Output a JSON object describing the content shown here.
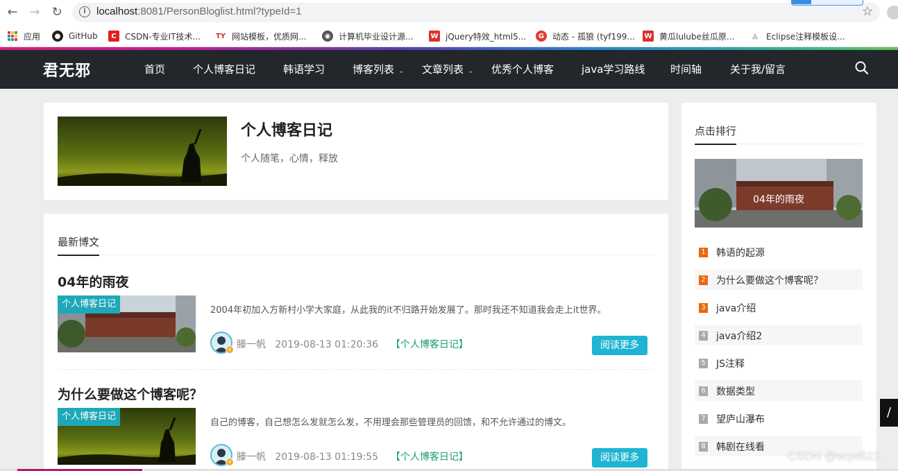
{
  "browser": {
    "url_host": "localhost",
    "url_rest": ":8081/PersonBloglist.html?typeId=1",
    "bookmarks": [
      {
        "label": "应用",
        "icon": "apps-grid-icon"
      },
      {
        "label": "GitHub",
        "icon": "github-icon"
      },
      {
        "label": "CSDN-专业IT技术...",
        "icon": "csdn-icon"
      },
      {
        "label": "网站模板，优质网...",
        "icon": "ty-icon"
      },
      {
        "label": "计算机毕业设计源...",
        "icon": "globe-icon"
      },
      {
        "label": "jQuery特效_html5...",
        "icon": "jq-icon"
      },
      {
        "label": "动态 - 孤狼 (tyf199...",
        "icon": "weibo-icon"
      },
      {
        "label": "黄瓜lulube丝瓜原...",
        "icon": "jq-icon"
      },
      {
        "label": "Eclipse注释模板设...",
        "icon": "eclipse-icon"
      }
    ]
  },
  "site": {
    "logo": "君无邪",
    "menu": [
      {
        "label": "首页",
        "dropdown": false
      },
      {
        "label": "个人博客日记",
        "dropdown": false
      },
      {
        "label": "韩语学习",
        "dropdown": false
      },
      {
        "label": "博客列表",
        "dropdown": true
      },
      {
        "label": "文章列表",
        "dropdown": true
      },
      {
        "label": "优秀个人博客",
        "dropdown": false
      },
      {
        "label": "java学习路线",
        "dropdown": false
      },
      {
        "label": "时间轴",
        "dropdown": false
      },
      {
        "label": "关于我/留言",
        "dropdown": false
      }
    ]
  },
  "profile": {
    "title": "个人博客日记",
    "subtitle": "个人随笔，心情，释放"
  },
  "posts_section": {
    "heading": "最新博文",
    "posts": [
      {
        "title": "04年的雨夜",
        "tag": "个人博客日记",
        "excerpt": "2004年初加入方新村小学大家庭，从此我的it不归路开始发展了。那时我还不知道我会走上it世界。",
        "author": "滕一帆",
        "date": "2019-08-13 01:20:36",
        "category": "个人博客日记",
        "read_more": "阅读更多"
      },
      {
        "title": "为什么要做这个博客呢？",
        "tag": "个人博客日记",
        "excerpt": "自己的博客，自己想怎么发就怎么发，不用理会那些管理员的回馈，和不允许通过的博文。",
        "author": "滕一帆",
        "date": "2019-08-13 01:19:55",
        "category": "个人博客日记",
        "read_more": "阅读更多"
      }
    ]
  },
  "sidebar": {
    "heading": "点击排行",
    "featured_caption": "04年的雨夜",
    "ranking": [
      {
        "num": "1",
        "label": "韩语的起源",
        "color": "#f0650f"
      },
      {
        "num": "2",
        "label": "为什么要做这个博客呢？",
        "color": "#f0650f"
      },
      {
        "num": "3",
        "label": "java介绍",
        "color": "#f0650f"
      },
      {
        "num": "4",
        "label": "java介绍2",
        "color": "#aaaaaa"
      },
      {
        "num": "5",
        "label": "JS注释",
        "color": "#aaaaaa"
      },
      {
        "num": "6",
        "label": "数据类型",
        "color": "#aaaaaa"
      },
      {
        "num": "7",
        "label": "望庐山瀑布",
        "color": "#aaaaaa"
      },
      {
        "num": "8",
        "label": "韩剧在线看",
        "color": "#aaaaaa"
      }
    ]
  },
  "watermark": "CSDN @wqw821"
}
